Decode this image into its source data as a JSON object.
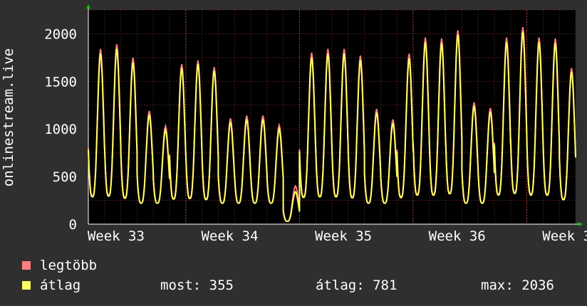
{
  "chart_data": {
    "type": "line",
    "title": "",
    "ylabel": "onlinestream.live",
    "xlabel": "",
    "ylim": [
      0,
      2250
    ],
    "y_ticks": [
      0,
      500,
      1000,
      1500,
      2000
    ],
    "x_tick_labels": [
      "Week 33",
      "Week 34",
      "Week 35",
      "Week 36",
      "Week 3"
    ],
    "grid": true,
    "x_unit": "day",
    "x_range": [
      0,
      30
    ],
    "daily_peaks": {
      "x": [
        0.75,
        1.75,
        2.75,
        3.75,
        4.75,
        5.75,
        6.75,
        7.75,
        8.75,
        9.75,
        10.75,
        11.75,
        12.75,
        13.75,
        14.75,
        15.75,
        16.75,
        17.75,
        18.75,
        19.75,
        20.75,
        21.75,
        22.75,
        23.75,
        24.75,
        25.75,
        26.75,
        27.75,
        28.75,
        29.75
      ],
      "max": [
        1840,
        1890,
        1750,
        1190,
        1030,
        1680,
        1720,
        1650,
        1110,
        1140,
        1140,
        1040,
        400,
        1800,
        1840,
        1840,
        1770,
        1210,
        1100,
        1790,
        1960,
        1950,
        2036,
        1280,
        1220,
        1960,
        2070,
        1960,
        1950,
        1640
      ],
      "avg": [
        1790,
        1840,
        1700,
        1150,
        990,
        1640,
        1680,
        1610,
        1070,
        1100,
        1100,
        1000,
        340,
        1750,
        1790,
        1790,
        1720,
        1170,
        1060,
        1740,
        1910,
        1900,
        1990,
        1240,
        1180,
        1910,
        2020,
        1910,
        1900,
        1600
      ]
    },
    "series": [
      {
        "name": "legtöbb",
        "color": "#ff7f7f"
      },
      {
        "name": "átlag",
        "color": "#ffff66"
      }
    ],
    "legend_placement": "bottom-left"
  },
  "legend": {
    "max_label": "legtöbb",
    "avg_label": "átlag"
  },
  "stats": {
    "current": "most: 355",
    "average": "átlag: 781",
    "maximum": "max: 2036"
  },
  "colors": {
    "background": "#2f2f2f",
    "plot_bg": "#000000",
    "grid": "#6a2a2a",
    "max_series": "#ff7f7f",
    "avg_series": "#ffff66",
    "arrow": "#00cc00"
  }
}
